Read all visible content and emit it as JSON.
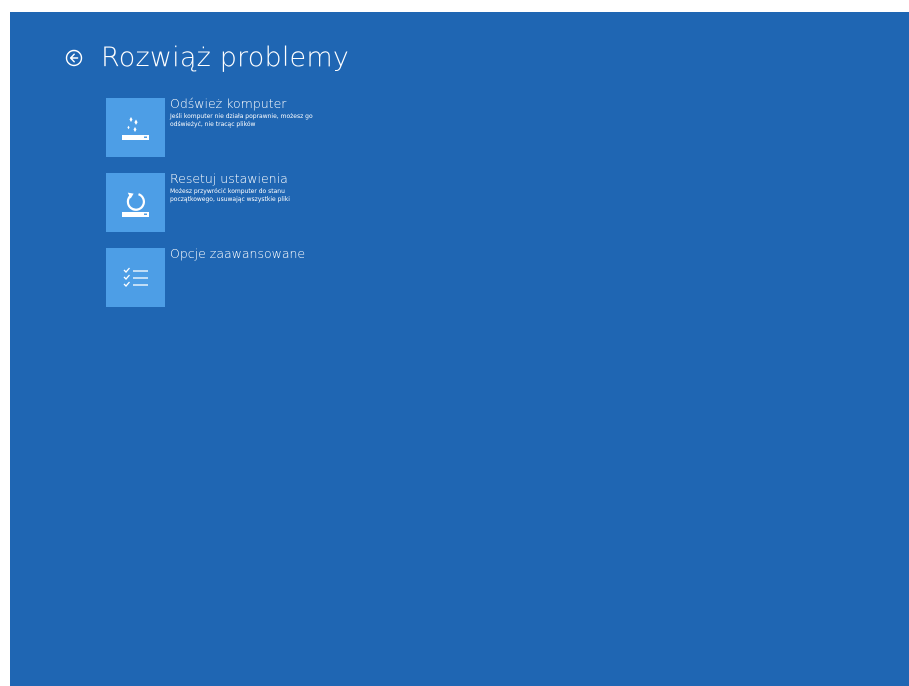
{
  "page": {
    "title": "Rozwiąż problemy",
    "back_icon": "back-arrow-circle-icon"
  },
  "options": [
    {
      "title": "Odśwież komputer",
      "description": "Jeśli komputer nie działa poprawnie, możesz go odświeżyć, nie tracąc plików",
      "icon": "refresh-sparkle-icon"
    },
    {
      "title": "Resetuj ustawienia",
      "description": "Możesz przywrócić komputer do stanu początkowego, usuwając wszystkie pliki",
      "icon": "reset-circular-arrow-icon"
    },
    {
      "title": "Opcje zaawansowane",
      "description": "",
      "icon": "checklist-icon"
    }
  ],
  "colors": {
    "background": "#1f66b3",
    "tile": "#4d9ee6",
    "text": "#ffffff"
  }
}
